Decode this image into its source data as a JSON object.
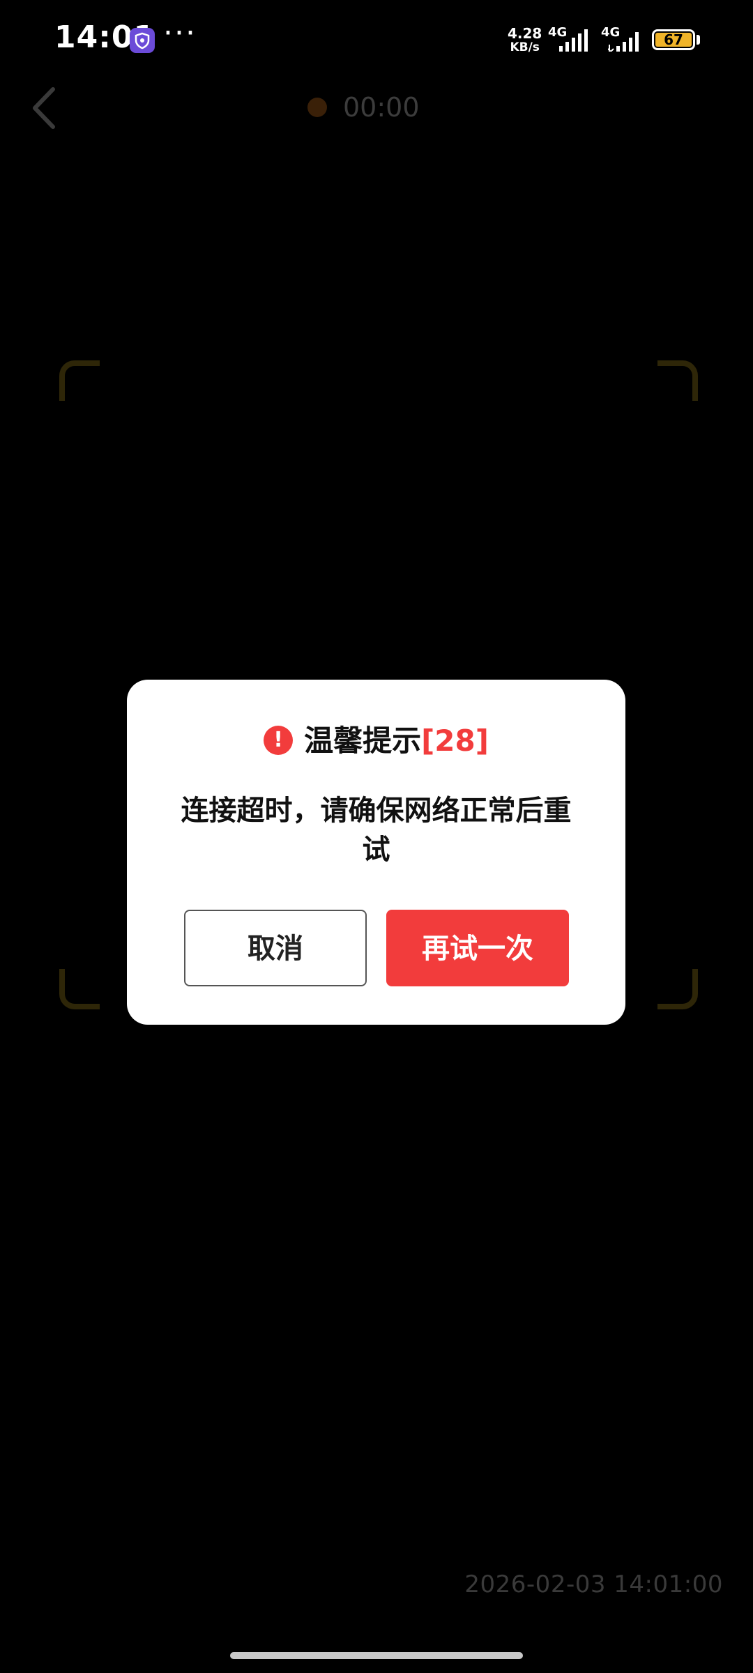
{
  "status_bar": {
    "time": "14:01",
    "more": "···",
    "speed_value": "4.28",
    "speed_unit": "KB/s",
    "net1": "4G",
    "net2": "4G",
    "battery": "67"
  },
  "recording": {
    "timer": "00:00"
  },
  "dialog": {
    "icon_glyph": "!",
    "title": "温馨提示",
    "countdown": "[28]",
    "message": "连接超时，请确保网络正常后重试",
    "cancel_label": "取消",
    "retry_label": "再试一次"
  },
  "watermark": {
    "timestamp": "2026-02-03 14:01:00"
  },
  "colors": {
    "accent": "#f23c3c",
    "battery": "#f0b429",
    "background": "#000000"
  },
  "icons": {
    "back": "chevron-left-icon",
    "alert": "alert-circle-icon",
    "app": "shield-app-icon"
  }
}
